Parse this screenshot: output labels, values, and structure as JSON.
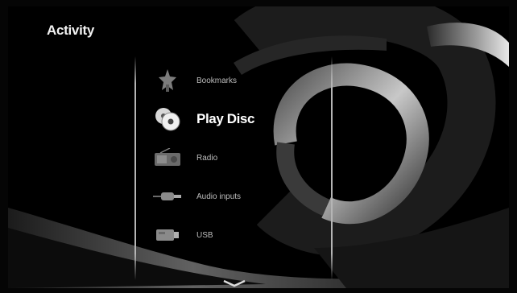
{
  "header": {
    "title": "Activity"
  },
  "menu": {
    "items": [
      {
        "label": "Bookmarks",
        "icon": "bookmark-star-icon",
        "selected": false
      },
      {
        "label": "Play Disc",
        "icon": "disc-icon",
        "selected": true
      },
      {
        "label": "Radio",
        "icon": "radio-icon",
        "selected": false
      },
      {
        "label": "Audio inputs",
        "icon": "audio-input-plug-icon",
        "selected": false
      },
      {
        "label": "USB",
        "icon": "usb-drive-icon",
        "selected": false
      }
    ]
  },
  "navigation": {
    "scroll_icon": "chevron-down-icon"
  },
  "colors": {
    "background": "#000000",
    "text": "#ffffff",
    "dim_text": "#bdbdbd"
  }
}
